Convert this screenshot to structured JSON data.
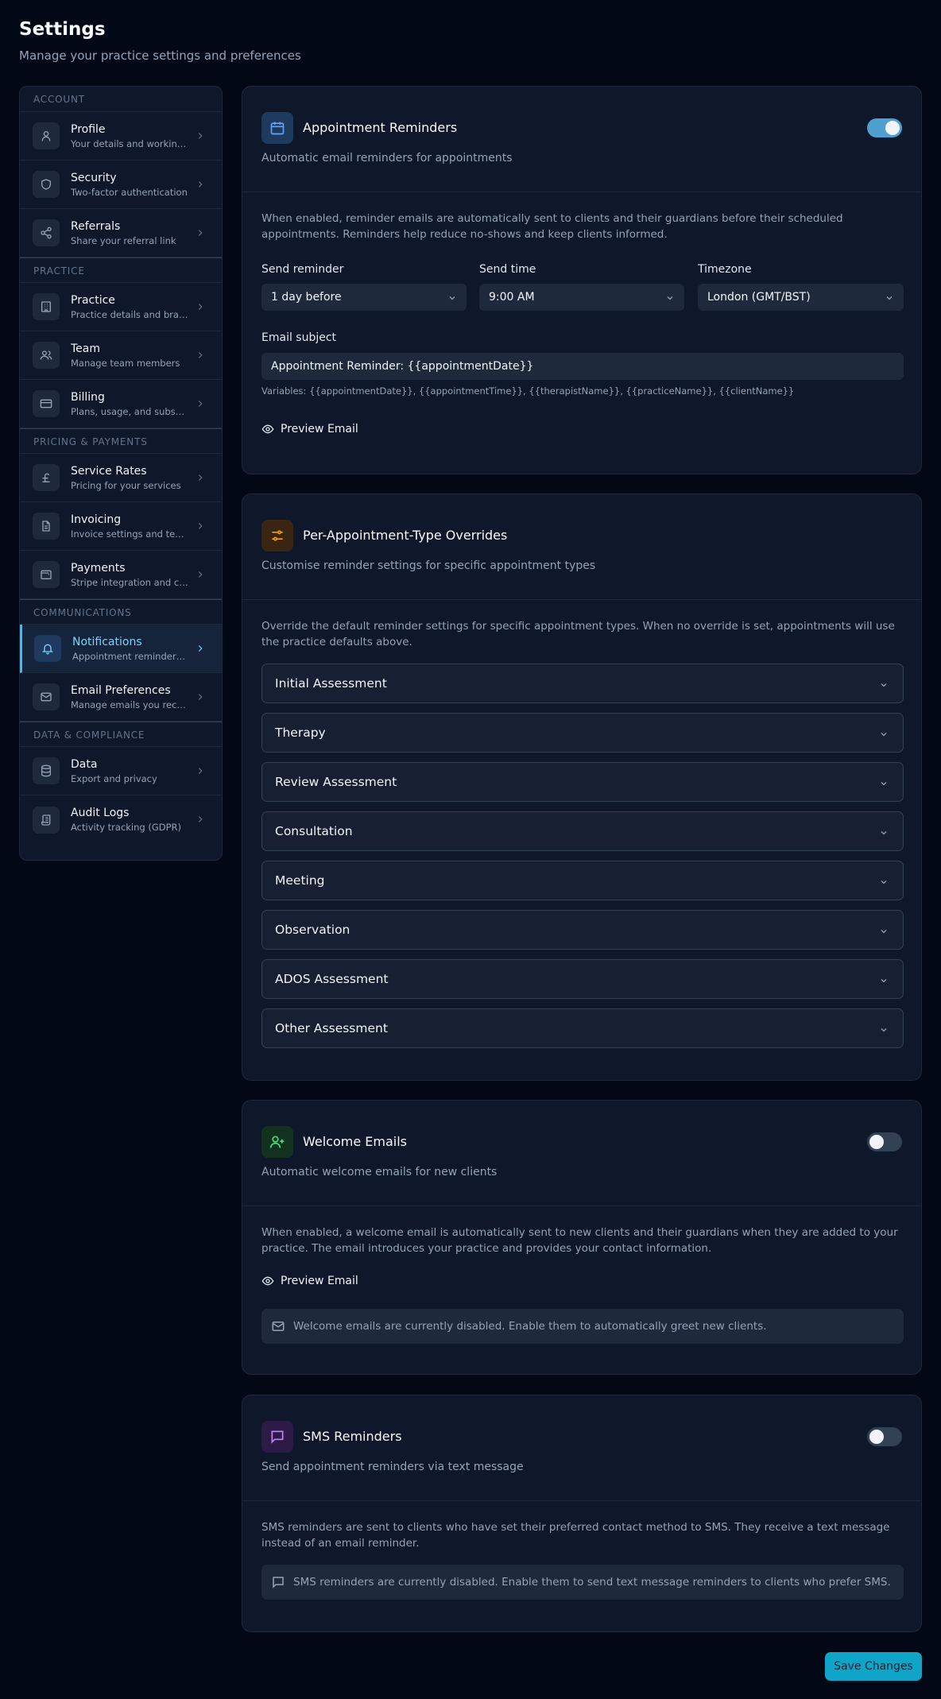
{
  "header": {
    "title": "Settings",
    "subtitle": "Manage your practice settings and preferences"
  },
  "sidebar": {
    "sections": [
      {
        "title": "ACCOUNT",
        "items": [
          {
            "label": "Profile",
            "desc": "Your details and working hours",
            "icon": "user-icon"
          },
          {
            "label": "Security",
            "desc": "Two-factor authentication",
            "icon": "shield-icon"
          },
          {
            "label": "Referrals",
            "desc": "Share your referral link",
            "icon": "share-icon"
          }
        ]
      },
      {
        "title": "PRACTICE",
        "items": [
          {
            "label": "Practice",
            "desc": "Practice details and branding",
            "icon": "building-icon"
          },
          {
            "label": "Team",
            "desc": "Manage team members",
            "icon": "users-icon"
          },
          {
            "label": "Billing",
            "desc": "Plans, usage, and subscription",
            "icon": "credit-card-icon"
          }
        ]
      },
      {
        "title": "PRICING & PAYMENTS",
        "items": [
          {
            "label": "Service Rates",
            "desc": "Pricing for your services",
            "icon": "pound-icon"
          },
          {
            "label": "Invoicing",
            "desc": "Invoice settings and templates",
            "icon": "document-icon"
          },
          {
            "label": "Payments",
            "desc": "Stripe integration and cards",
            "icon": "wallet-icon"
          }
        ]
      },
      {
        "title": "COMMUNICATIONS",
        "items": [
          {
            "label": "Notifications",
            "desc": "Appointment reminders and emails",
            "icon": "bell-icon",
            "active": true
          },
          {
            "label": "Email Preferences",
            "desc": "Manage emails you receive",
            "icon": "mail-icon"
          }
        ]
      },
      {
        "title": "DATA & COMPLIANCE",
        "items": [
          {
            "label": "Data",
            "desc": "Export and privacy",
            "icon": "database-icon"
          },
          {
            "label": "Audit Logs",
            "desc": "Activity tracking (GDPR)",
            "icon": "scroll-icon"
          }
        ]
      }
    ]
  },
  "reminders": {
    "title": "Appointment Reminders",
    "desc": "Automatic email reminders for appointments",
    "enabled": true,
    "body": "When enabled, reminder emails are automatically sent to clients and their guardians before their scheduled appointments. Reminders help reduce no-shows and keep clients informed.",
    "send_reminder_label": "Send reminder",
    "send_reminder_value": "1 day before",
    "send_time_label": "Send time",
    "send_time_value": "9:00 AM",
    "timezone_label": "Timezone",
    "timezone_value": "London (GMT/BST)",
    "subject_label": "Email subject",
    "subject_value": "Appointment Reminder: {{appointmentDate}}",
    "variables": "Variables: {{appointmentDate}}, {{appointmentTime}}, {{therapistName}}, {{practiceName}}, {{clientName}}",
    "preview_label": "Preview Email",
    "accent": "#4f9fd0"
  },
  "overrides": {
    "title": "Per-Appointment-Type Overrides",
    "desc": "Customise reminder settings for specific appointment types",
    "body": "Override the default reminder settings for specific appointment types. When no override is set, appointments will use the practice defaults above.",
    "types": [
      "Initial Assessment",
      "Therapy",
      "Review Assessment",
      "Consultation",
      "Meeting",
      "Observation",
      "ADOS Assessment",
      "Other Assessment"
    ]
  },
  "welcome": {
    "title": "Welcome Emails",
    "desc": "Automatic welcome emails for new clients",
    "enabled": false,
    "body": "When enabled, a welcome email is automatically sent to new clients and their guardians when they are added to your practice. The email introduces your practice and provides your contact information.",
    "preview_label": "Preview Email",
    "notice": "Welcome emails are currently disabled. Enable them to automatically greet new clients."
  },
  "sms": {
    "title": "SMS Reminders",
    "desc": "Send appointment reminders via text message",
    "enabled": false,
    "body": "SMS reminders are sent to clients who have set their preferred contact method to SMS. They receive a text message instead of an email reminder.",
    "notice": "SMS reminders are currently disabled. Enable them to send text message reminders to clients who prefer SMS."
  },
  "footer": {
    "save_label": "Save Changes",
    "save_color": "#0ea5c9"
  }
}
